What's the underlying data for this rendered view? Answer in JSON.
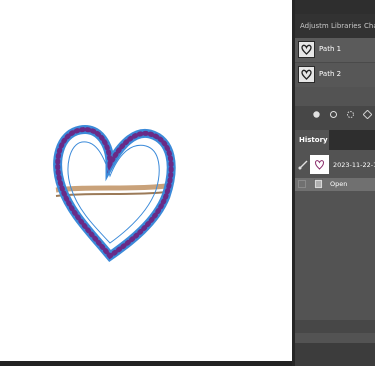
{
  "panel_tabs": {
    "adjustments": "Adjustm",
    "libraries": "Libraries",
    "channels": "Cha"
  },
  "paths": {
    "items": [
      {
        "label": "Path 1"
      },
      {
        "label": "Path 2"
      }
    ]
  },
  "history": {
    "tab_label": "History",
    "snapshot_label": "2023-11-22-11-",
    "items": [
      {
        "label": "Open"
      }
    ]
  },
  "colors": {
    "ring_metal": "#c9a27a",
    "gem": "#6a2a86",
    "path_outline": "#3b8ad9"
  }
}
